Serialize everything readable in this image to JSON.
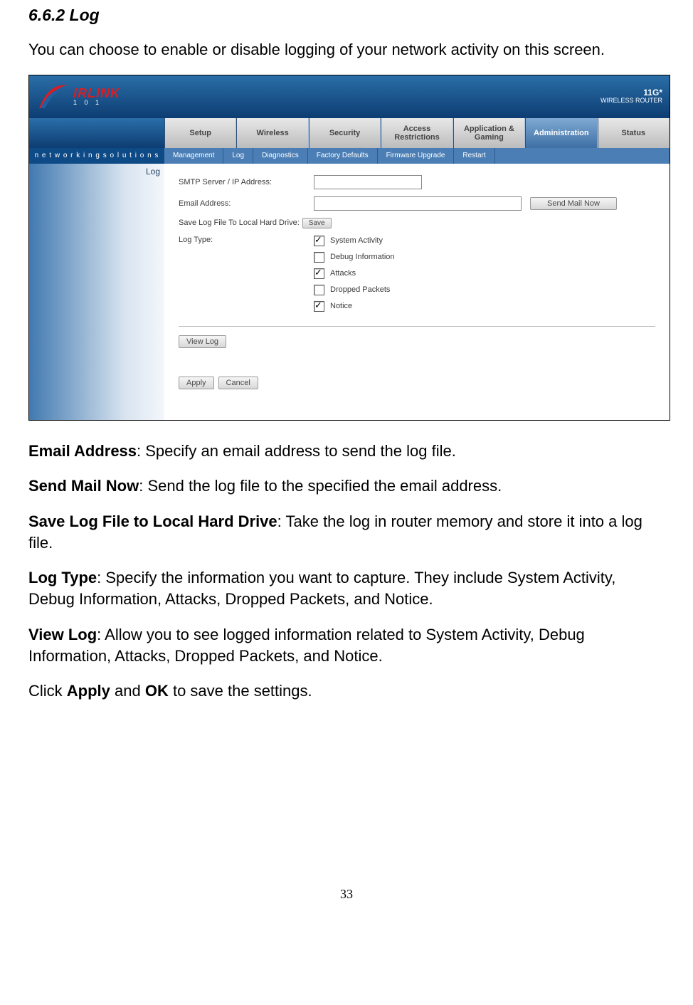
{
  "doc": {
    "heading": "6.6.2 Log",
    "intro": "You can choose to enable or disable logging of your network activity on this screen.",
    "p1_bold": "Email Address",
    "p1_rest": ": Specify an email address to send the log file.",
    "p2_bold": "Send Mail Now",
    "p2_rest": ": Send the log file to the specified the email address.",
    "p3_bold": "Save Log File to Local Hard Drive",
    "p3_rest": ": Take the log in router memory and store it into a log file.",
    "p4_bold": "Log Type",
    "p4_rest": ": Specify the information you want to capture. They include System Activity, Debug Information, Attacks, Dropped Packets, and Notice.",
    "p5_bold": "View Log",
    "p5_rest": ": Allow you to see logged information related to System Activity, Debug Information, Attacks, Dropped Packets, and Notice.",
    "p6_a": "Click ",
    "p6_b": "Apply",
    "p6_c": " and ",
    "p6_d": "OK",
    "p6_e": " to save the settings.",
    "page_number": "33"
  },
  "ui": {
    "brand": "IRLINK",
    "brand_sub": "1 0 1",
    "badge_top": "11G*",
    "badge_bottom": "WIRELESS ROUTER",
    "tagline": "n e t w o r k i n g s o l u t i o n s",
    "tabs": [
      "Setup",
      "Wireless",
      "Security",
      "Access Restrictions",
      "Application & Gaming",
      "Administration",
      "Status"
    ],
    "subtabs": [
      "Management",
      "Log",
      "Diagnostics",
      "Factory Defaults",
      "Firmware Upgrade",
      "Restart"
    ],
    "side_label": "Log",
    "smtp_label": "SMTP Server / IP Address:",
    "email_label": "Email Address:",
    "send_mail_btn": "Send Mail Now",
    "save_log_label": "Save Log File To Local Hard Drive:",
    "save_btn": "Save",
    "log_type_label": "Log Type:",
    "checks": [
      {
        "label": "System Activity",
        "checked": true
      },
      {
        "label": "Debug Information",
        "checked": false
      },
      {
        "label": "Attacks",
        "checked": true
      },
      {
        "label": "Dropped Packets",
        "checked": false
      },
      {
        "label": "Notice",
        "checked": true
      }
    ],
    "view_log_btn": "View Log",
    "apply_btn": "Apply",
    "cancel_btn": "Cancel"
  }
}
